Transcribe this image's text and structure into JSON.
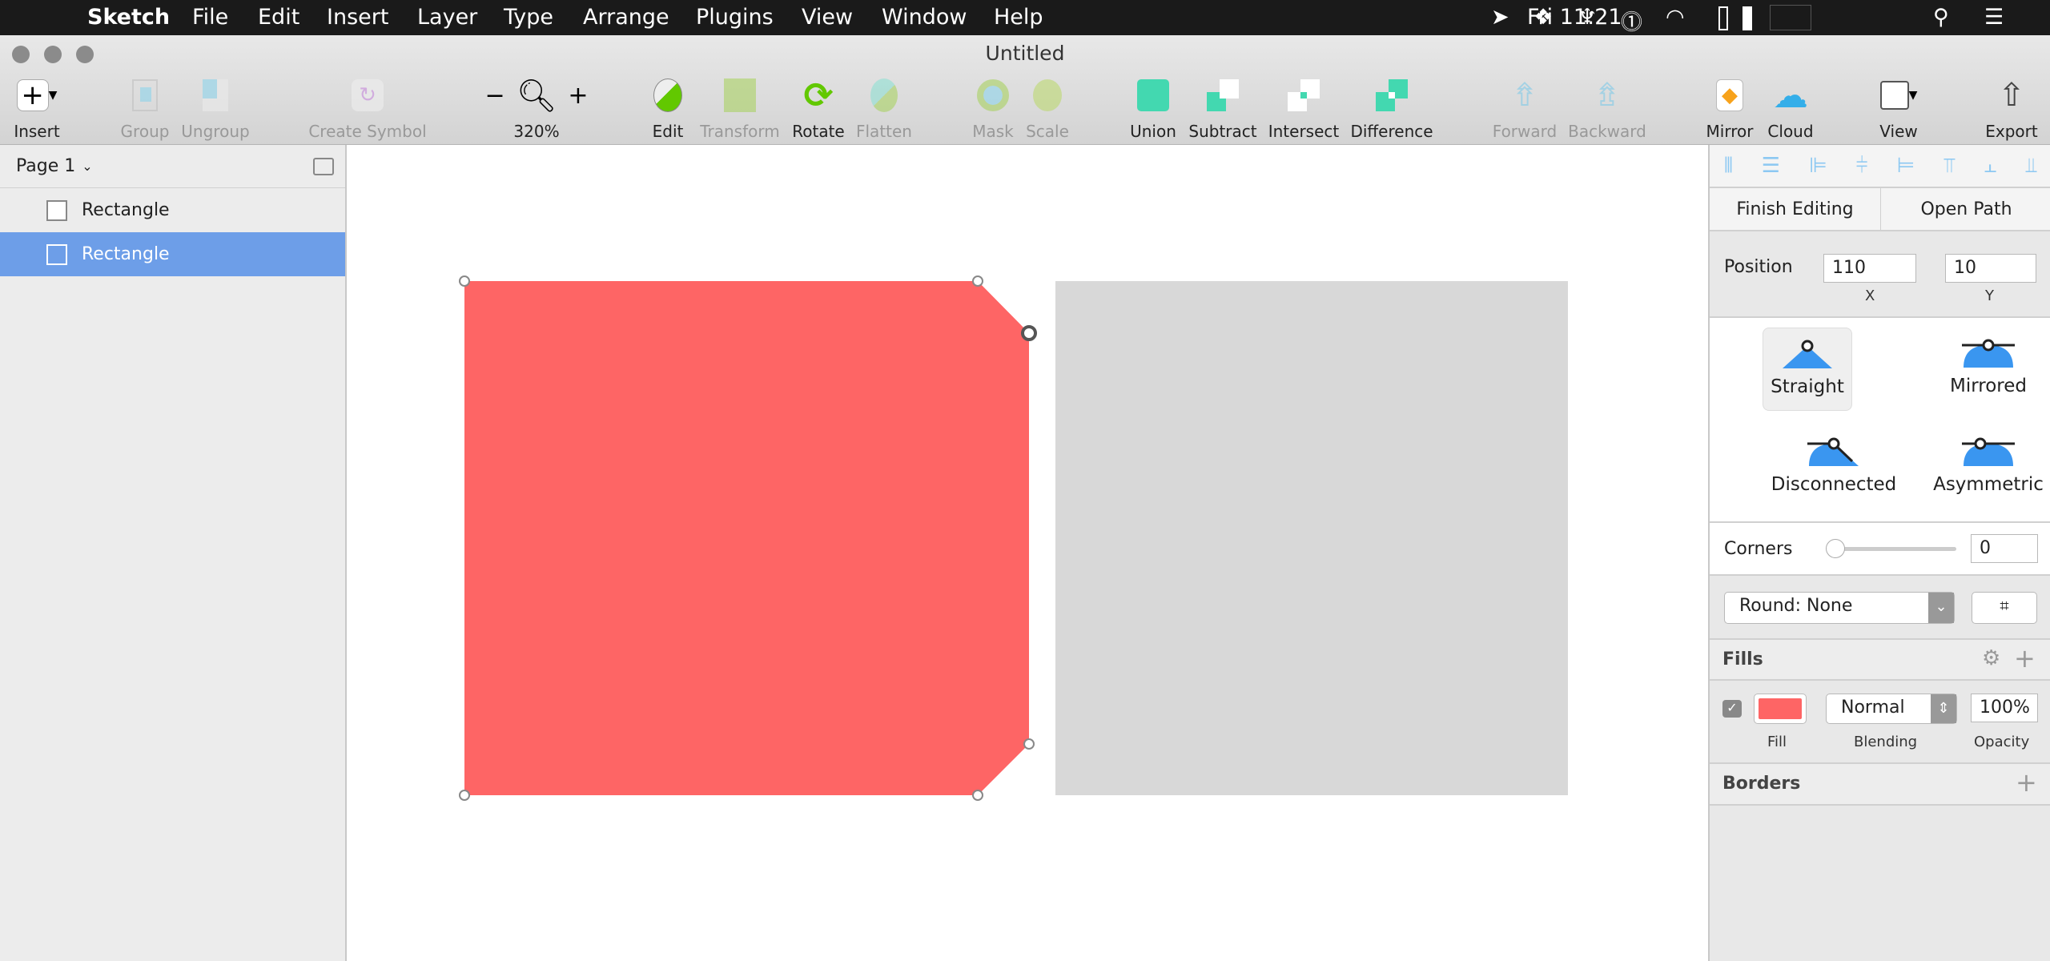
{
  "menubar": {
    "app": "Sketch",
    "items": [
      "File",
      "Edit",
      "Insert",
      "Layer",
      "Type",
      "Arrange",
      "Plugins",
      "View",
      "Window",
      "Help"
    ],
    "clock": "Fri 11:21"
  },
  "window": {
    "title": "Untitled"
  },
  "toolbar": {
    "insert": "Insert",
    "group": "Group",
    "ungroup": "Ungroup",
    "create_symbol": "Create Symbol",
    "zoom": "320%",
    "zoom_minus": "−",
    "zoom_plus": "+",
    "edit": "Edit",
    "transform": "Transform",
    "rotate": "Rotate",
    "flatten": "Flatten",
    "mask": "Mask",
    "scale": "Scale",
    "union": "Union",
    "subtract": "Subtract",
    "intersect": "Intersect",
    "difference": "Difference",
    "forward": "Forward",
    "backward": "Backward",
    "mirror": "Mirror",
    "cloud": "Cloud",
    "view": "View",
    "export": "Export"
  },
  "sidebar": {
    "page": "Page 1",
    "layers": [
      {
        "name": "Rectangle",
        "selected": false
      },
      {
        "name": "Rectangle",
        "selected": true
      }
    ]
  },
  "canvas": {
    "shape_fill": "#fe6565",
    "other_fill": "#d8d8d8"
  },
  "inspector": {
    "finish_editing": "Finish Editing",
    "open_path": "Open Path",
    "position_label": "Position",
    "x": "110",
    "y": "10",
    "x_label": "X",
    "y_label": "Y",
    "point_types": [
      "Straight",
      "Mirrored",
      "Disconnected",
      "Asymmetric"
    ],
    "selected_point_type": "Straight",
    "corners_label": "Corners",
    "corners_value": "0",
    "round": "Round: None",
    "fills_title": "Fills",
    "fill_color": "#fe6565",
    "blending": "Normal",
    "opacity": "100%",
    "fill_label": "Fill",
    "blending_label": "Blending",
    "opacity_label": "Opacity",
    "borders_title": "Borders"
  }
}
